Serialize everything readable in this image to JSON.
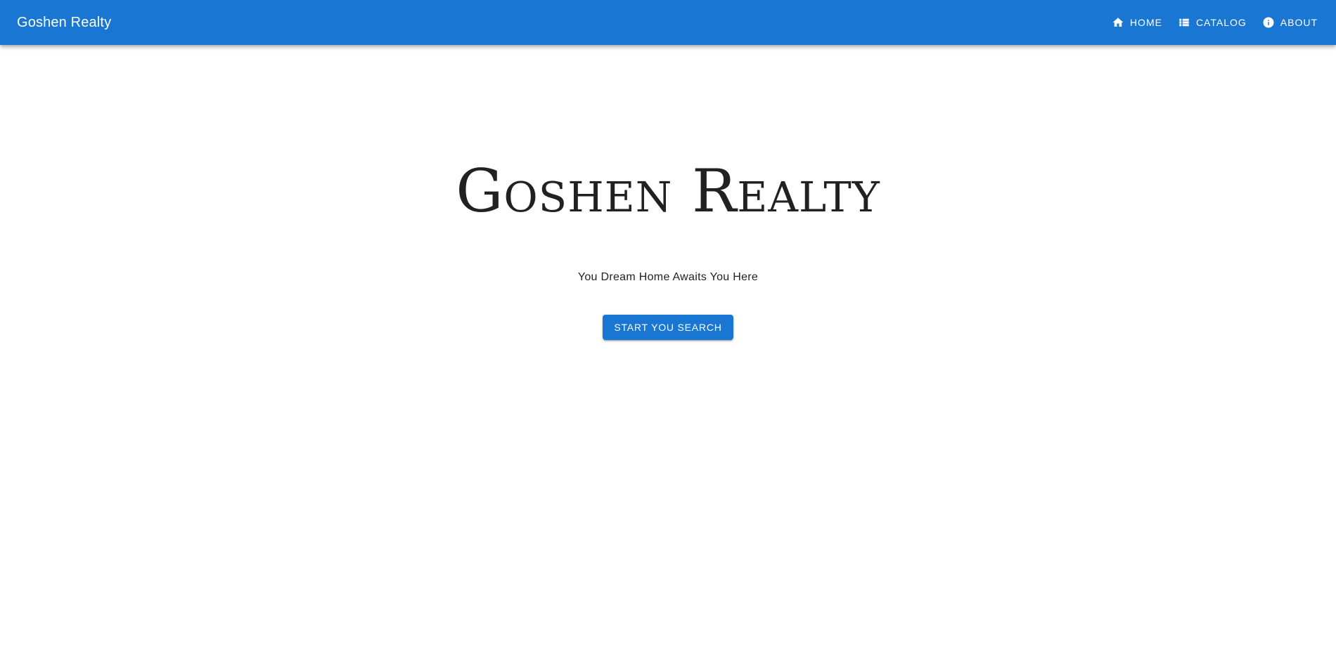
{
  "app_bar": {
    "title": "Goshen Realty",
    "color": "#1976d2",
    "nav": [
      {
        "label": "HOME",
        "icon": "home-icon"
      },
      {
        "label": "CATALOG",
        "icon": "list-icon"
      },
      {
        "label": "ABOUT",
        "icon": "info-icon"
      }
    ]
  },
  "hero": {
    "title": "Goshen Realty",
    "subtitle": "You Dream Home Awaits You Here",
    "cta_label": "START YOU SEARCH"
  }
}
